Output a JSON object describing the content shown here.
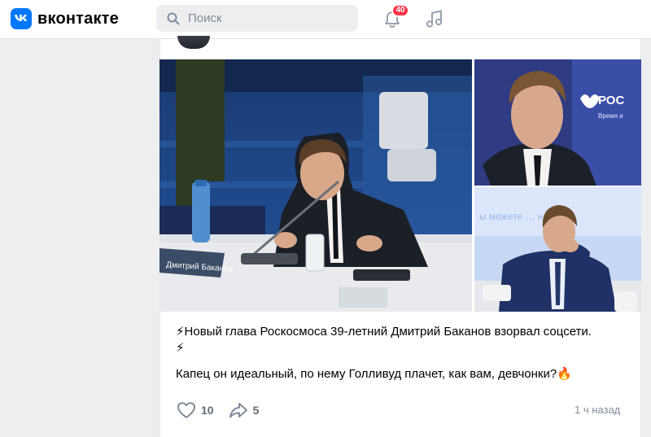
{
  "header": {
    "logo_text": "вконтакте",
    "search_placeholder": "Поиск",
    "notifications_count": "40"
  },
  "post": {
    "text_line1": "⚡Новый глава Роскосмоса 39-летний Дмитрий Баканов взорвал соцсети.",
    "text_line1b": "⚡",
    "text_line2": "Капец он идеальный, по нему Голливуд плачет, как вам, девчонки?🔥",
    "likes": "10",
    "shares": "5",
    "time": "1 ч назад",
    "nameplate": "Дмитрий Баканов",
    "banner_text_top": "РОС",
    "banner_text_top2": "Время и",
    "banner_text_bottom": "ы можете … наше"
  },
  "colors": {
    "accent": "#0077ff",
    "badge": "#ff3347",
    "page_bg": "#edeef0"
  }
}
